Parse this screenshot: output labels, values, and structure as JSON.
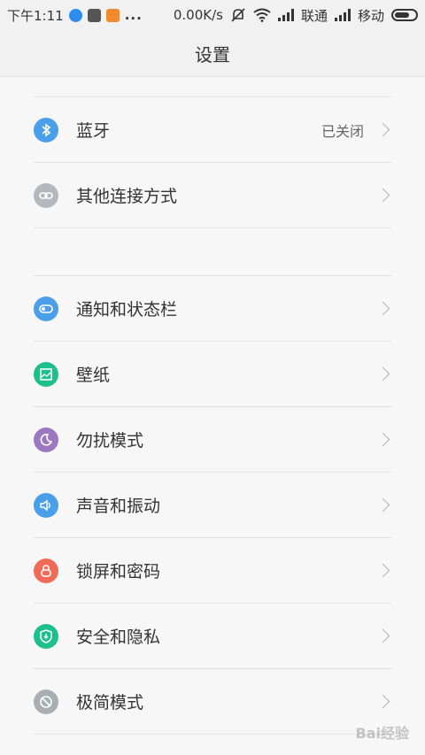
{
  "statusbar": {
    "time": "下午1:11",
    "speed": "0.00K/s",
    "carrier1": "联通",
    "carrier2": "移动",
    "dots": "..."
  },
  "header": {
    "title": "设置"
  },
  "items": [
    {
      "label": "蓝牙",
      "status": "已关闭",
      "icon": "bluetooth-icon",
      "color": "#4b9ee8"
    },
    {
      "label": "其他连接方式",
      "icon": "link-icon",
      "color": "#b4b8bd"
    },
    {
      "label": "通知和状态栏",
      "icon": "toggle-icon",
      "color": "#4b9ee8"
    },
    {
      "label": "壁纸",
      "icon": "wallpaper-icon",
      "color": "#1dbf8a"
    },
    {
      "label": "勿扰模式",
      "icon": "moon-icon",
      "color": "#9c78c0"
    },
    {
      "label": "声音和振动",
      "icon": "speaker-icon",
      "color": "#4b9ee8"
    },
    {
      "label": "锁屏和密码",
      "icon": "lock-icon",
      "color": "#ef6b58"
    },
    {
      "label": "安全和隐私",
      "icon": "shield-icon",
      "color": "#1dbf8a"
    },
    {
      "label": "极简模式",
      "icon": "simple-mode-icon",
      "color": "#a8aeb3"
    }
  ],
  "watermark": "Bai经验"
}
